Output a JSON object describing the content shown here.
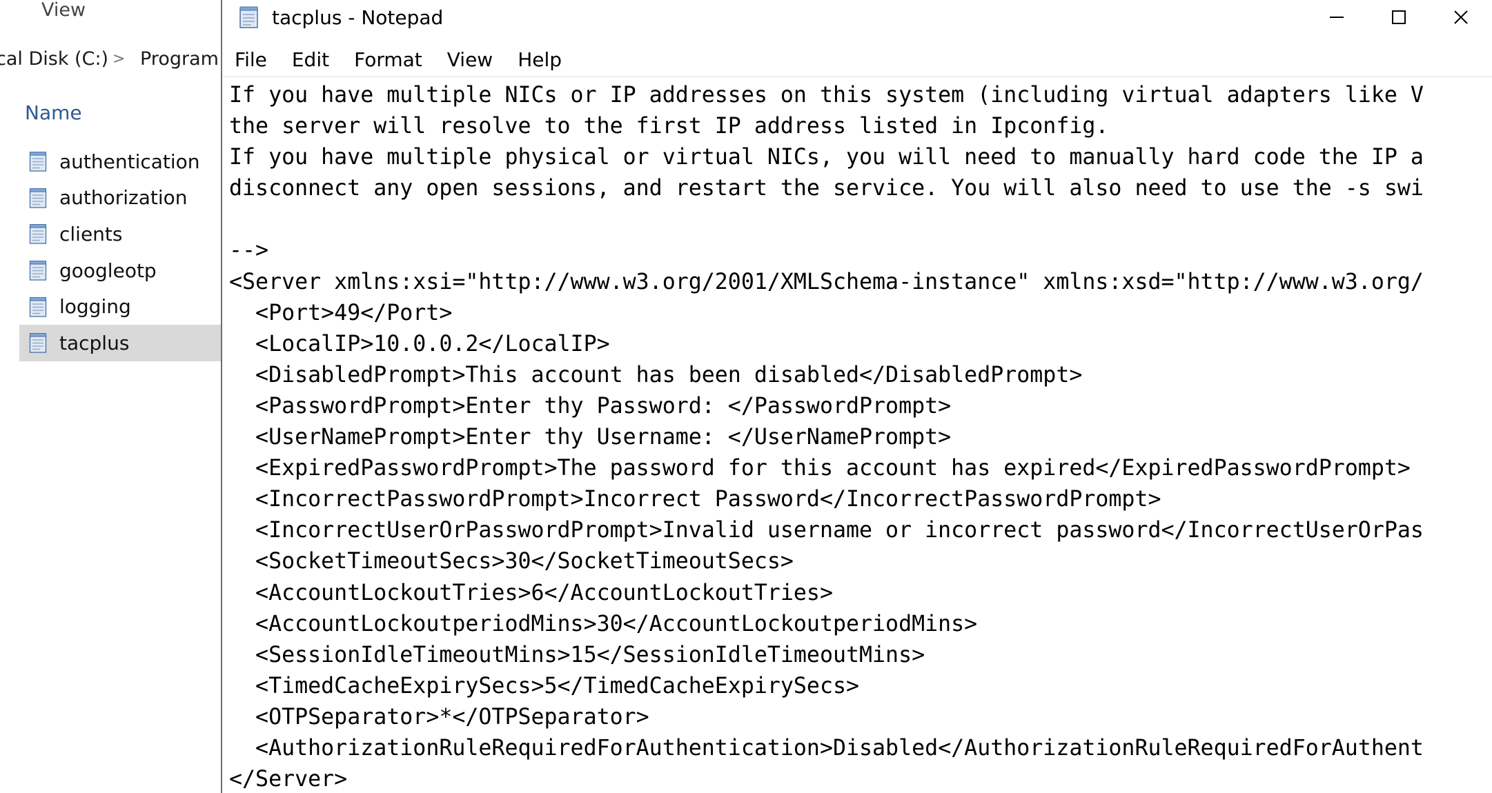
{
  "explorer": {
    "view_tab": "View",
    "address": {
      "crumb1": "cal Disk (C:)",
      "separator": ">",
      "crumb2": "Program"
    },
    "column_name": "Name",
    "files": [
      {
        "label": "authentication",
        "selected": false
      },
      {
        "label": "authorization",
        "selected": false
      },
      {
        "label": "clients",
        "selected": false
      },
      {
        "label": "googleotp",
        "selected": false
      },
      {
        "label": "logging",
        "selected": false
      },
      {
        "label": "tacplus",
        "selected": true
      }
    ]
  },
  "notepad": {
    "title": "tacplus - Notepad",
    "window_controls": {
      "minimize": "minimize-icon",
      "maximize": "maximize-icon",
      "close": "close-icon"
    },
    "menu": [
      "File",
      "Edit",
      "Format",
      "View",
      "Help"
    ],
    "lines": [
      "If you have multiple NICs or IP addresses on this system (including virtual adapters like V",
      "the server will resolve to the first IP address listed in Ipconfig.",
      "If you have multiple physical or virtual NICs, you will need to manually hard code the IP a",
      "disconnect any open sessions, and restart the service. You will also need to use the -s swi",
      "",
      "-->",
      "<Server xmlns:xsi=\"http://www.w3.org/2001/XMLSchema-instance\" xmlns:xsd=\"http://www.w3.org/",
      "  <Port>49</Port>",
      "  <LocalIP>10.0.0.2</LocalIP>",
      "  <DisabledPrompt>This account has been disabled</DisabledPrompt>",
      "  <PasswordPrompt>Enter thy Password: </PasswordPrompt>",
      "  <UserNamePrompt>Enter thy Username: </UserNamePrompt>",
      "  <ExpiredPasswordPrompt>The password for this account has expired</ExpiredPasswordPrompt>",
      "  <IncorrectPasswordPrompt>Incorrect Password</IncorrectPasswordPrompt>",
      "  <IncorrectUserOrPasswordPrompt>Invalid username or incorrect password</IncorrectUserOrPas",
      "  <SocketTimeoutSecs>30</SocketTimeoutSecs>",
      "  <AccountLockoutTries>6</AccountLockoutTries>",
      "  <AccountLockoutperiodMins>30</AccountLockoutperiodMins>",
      "  <SessionIdleTimeoutMins>15</SessionIdleTimeoutMins>",
      "  <TimedCacheExpirySecs>5</TimedCacheExpirySecs>",
      "  <OTPSeparator>*</OTPSeparator>",
      "  <AuthorizationRuleRequiredForAuthentication>Disabled</AuthorizationRuleRequiredForAuthent",
      "</Server>"
    ]
  },
  "colors": {
    "selected_bg": "#d9d9d9",
    "column_header": "#2e5a8e",
    "pane_border": "#6e6e6e"
  }
}
